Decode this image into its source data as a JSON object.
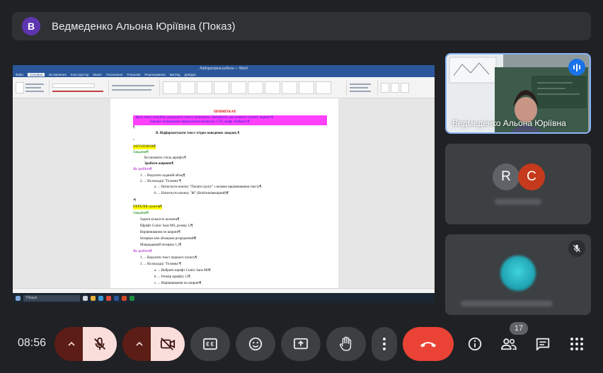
{
  "presenter_bar": {
    "avatar_letter": "B",
    "title": "Ведмеденко Альона Юріївна (Показ)"
  },
  "shared_screen": {
    "word_title": "Лабораторна робота — Word",
    "tabs": [
      "Файл",
      "Основне",
      "Вставлення",
      "Конструктор",
      "Макет",
      "Посилання",
      "Розсилки",
      "Рецензування",
      "Вигляд",
      "Довідка"
    ],
    "document": {
      "heading": "ПРИМІТКА¶",
      "note_line1": "Весь текст потрібно довільного змісту визначити. Визначити для кожного пункту окремо.¶",
      "note_line2": "Бажано ініціювання оформлення матеріалу СТЕ, цифр. Вибрати.¶",
      "task": "В. Відформатувати текст згідно наведених завдань.¶",
      "section1": "ЗАГОЛОВОК¶",
      "s1_sub1": "Завдання¶",
      "s1_item1": "Встановити стиль шрифту¶",
      "s1_item2": "Зробити жирним¶",
      "s1_sub2": "Як зробити¶",
      "s1_step1": "1.→ Виділити заданий абзац¶",
      "s1_step2": "2.→ На вкладці \"Головна\"¶",
      "s1_step2a": "a.→ Натиснути кнопку \"Почати групу\" з назвою вирівнювання тексту¶",
      "s1_step2b": "b.→ Натиснути кнопку \"Ж\" (Bold/напівжирний)¶",
      "section2": "ПЕРЕЛІК пунктів¶",
      "s2_sub1": "Завдання¶",
      "s2_item1": "Задати кількість колонок¶",
      "s2_item2": "Шрифт Comic Sans MS, розмір 12¶",
      "s2_item3": "Вирівнювання по ширині¶",
      "s2_item4": "Інтервал між абзацами розріджений¶",
      "s2_item5": "Міжрядковий інтервал 1,5¶",
      "s2_sub2": "Як зробити¶",
      "s2_step1": "1.→ Виділити текст першого пункту¶",
      "s2_step2": "2.→ На вкладці \"Головна\"¶",
      "s2_step2a": "a.→ Вибрати шрифт Comic Sans MS¶",
      "s2_step2b": "b.→ Розмір шрифту 12¶",
      "s2_step2c": "c.→ Вирівнювання по ширині¶"
    },
    "taskbar_search": "Пошук"
  },
  "participants": {
    "presenter_name": "Ведмеденко Альона Юріївна",
    "group_avatars": [
      {
        "letter": "R",
        "color": "#5f6368"
      },
      {
        "letter": "C",
        "color": "#c5391c"
      }
    ]
  },
  "controls": {
    "time": "08:56",
    "participant_count": "17"
  },
  "colors": {
    "hangup": "#ea4335",
    "speaking": "#1a73e8",
    "muted_split": "#5c1d16",
    "muted_face": "#f9dedc"
  }
}
